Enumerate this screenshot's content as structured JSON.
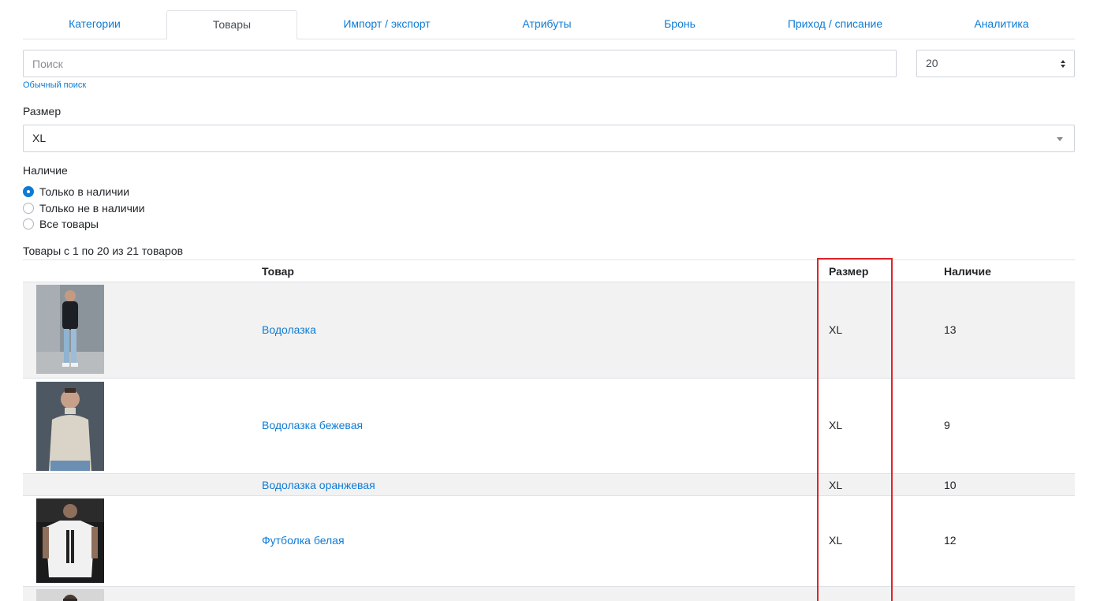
{
  "tabs": [
    {
      "label": "Категории",
      "active": false
    },
    {
      "label": "Товары",
      "active": true
    },
    {
      "label": "Импорт / экспорт",
      "active": false
    },
    {
      "label": "Атрибуты",
      "active": false
    },
    {
      "label": "Бронь",
      "active": false
    },
    {
      "label": "Приход / списание",
      "active": false
    },
    {
      "label": "Аналитика",
      "active": false
    }
  ],
  "search": {
    "placeholder": "Поиск",
    "value": "",
    "mode_link": "Обычный поиск"
  },
  "per_page": {
    "value": "20"
  },
  "size_filter": {
    "label": "Размер",
    "value": "XL"
  },
  "availability": {
    "label": "Наличие",
    "options": [
      {
        "label": "Только в наличии",
        "checked": true
      },
      {
        "label": "Только не в наличии",
        "checked": false
      },
      {
        "label": "Все товары",
        "checked": false
      }
    ]
  },
  "summary": "Товары с 1 по 20 из 21 товаров",
  "table": {
    "headers": {
      "product": "Товар",
      "size": "Размер",
      "stock": "Наличие"
    },
    "rows": [
      {
        "name": "Водолазка",
        "size": "XL",
        "stock": "13",
        "image": "black-turtleneck-photo"
      },
      {
        "name": "Водолазка бежевая",
        "size": "XL",
        "stock": "9",
        "image": "beige-turtleneck-photo"
      },
      {
        "name": "Водолазка оранжевая",
        "size": "XL",
        "stock": "10",
        "image": ""
      },
      {
        "name": "Футболка белая",
        "size": "XL",
        "stock": "12",
        "image": "white-tshirt-photo"
      },
      {
        "name": "",
        "size": "",
        "stock": "",
        "image": "partial-product-photo"
      }
    ]
  },
  "colors": {
    "accent": "#0d7bd6",
    "highlight": "#e0242a",
    "row_alt": "#f2f2f2"
  }
}
